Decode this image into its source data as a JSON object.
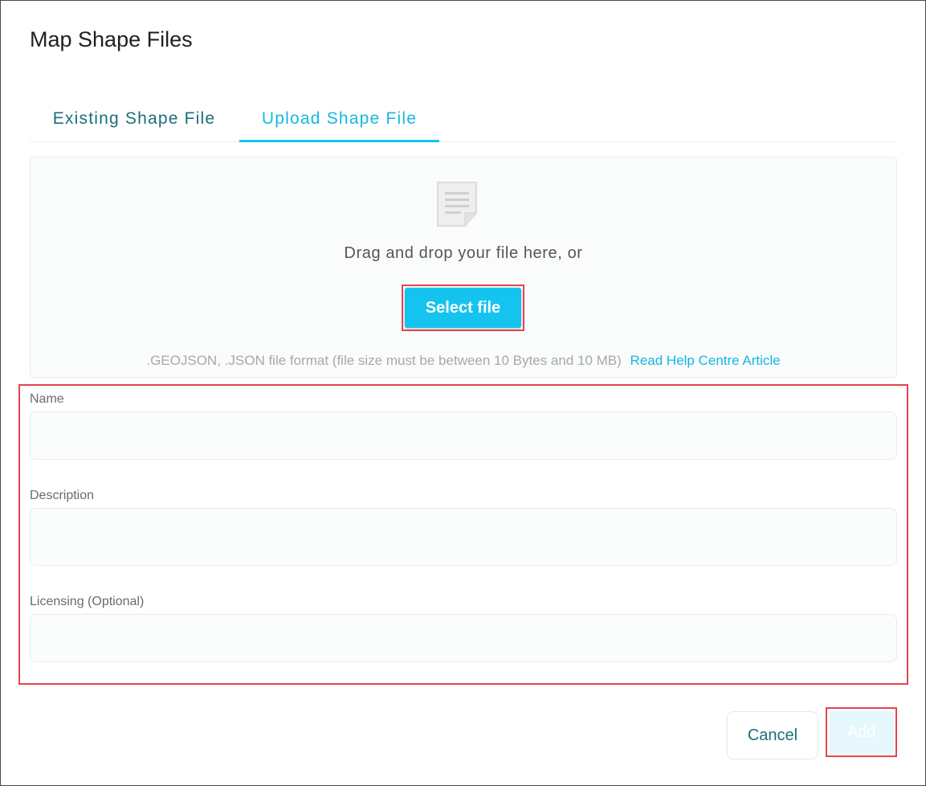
{
  "dialog": {
    "title": "Map Shape Files"
  },
  "tabs": [
    {
      "label": "Existing Shape File",
      "active": false
    },
    {
      "label": "Upload Shape File",
      "active": true
    }
  ],
  "upload": {
    "icon": "document-icon",
    "drag_text": "Drag and drop your file here, or",
    "select_label": "Select file",
    "format_text": ".GEOJSON, .JSON file format (file size must be between 10 Bytes and 10 MB)",
    "help_link": "Read Help Centre Article"
  },
  "form": {
    "name_label": "Name",
    "name_value": "",
    "description_label": "Description",
    "description_value": "",
    "licensing_label": "Licensing (Optional)",
    "licensing_value": ""
  },
  "actions": {
    "cancel_label": "Cancel",
    "add_label": "Add"
  },
  "colors": {
    "accent": "#14c4ee",
    "tab_inactive": "#1a6e7a",
    "highlight": "#e5454f"
  }
}
